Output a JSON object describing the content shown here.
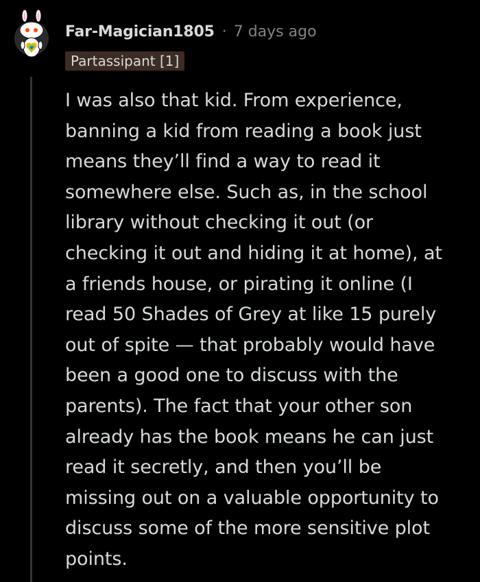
{
  "comment": {
    "username": "Far-Magician1805",
    "separator": "·",
    "timestamp": "7 days ago",
    "flair": "Partassipant [1]",
    "body_lines": [
      "I was also that kid. From experience,",
      "banning a kid from reading a book just",
      "means they’ll find a way to read it",
      "somewhere else. Such as, in the school",
      "library without checking it out (or",
      "checking it out and hiding it at home), at",
      "a friends house, or pirating it online (I",
      "read 50 Shades of Grey at like 15 purely",
      "out of spite — that probably would have",
      "been a good one to discuss with the",
      "parents). The fact that your other son",
      "already has the book means he can just",
      "read it secretly, and then you’ll be",
      "missing out on a valuable opportunity to",
      "discuss some of the more sensitive plot",
      "points."
    ]
  },
  "colors": {
    "background": "#000000",
    "text": "#d7dadc",
    "meta": "#818384",
    "flair_bg": "#3c2c24",
    "thread_line": "#343536"
  },
  "icons": {
    "avatar": "snoo-avatar-icon"
  }
}
